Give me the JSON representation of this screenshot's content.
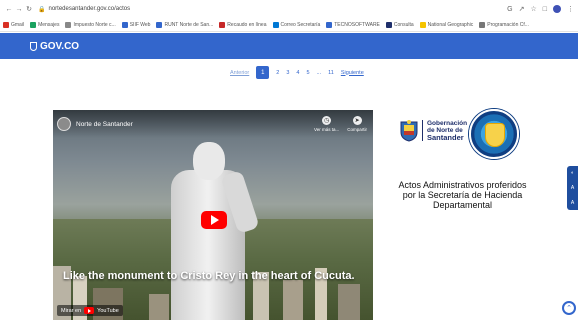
{
  "browser": {
    "url": "nortedesantander.gov.co/actos",
    "bookmarks": [
      {
        "label": "Gmail",
        "color": "#d93025"
      },
      {
        "label": "Mensajes",
        "color": "#1aa260"
      },
      {
        "label": "Impuesto Norte c...",
        "color": "#888888"
      },
      {
        "label": "SIIF Web",
        "color": "#3366cc"
      },
      {
        "label": "RUNT Norte de San...",
        "color": "#3366cc"
      },
      {
        "label": "Recaudo en línea",
        "color": "#c62828"
      },
      {
        "label": "Correo Secretaría",
        "color": "#0078d4"
      },
      {
        "label": "TECNOSOFTWARE",
        "color": "#3366cc"
      },
      {
        "label": "Consulta",
        "color": "#1f2f6b"
      },
      {
        "label": "National Geographic",
        "color": "#f5c400"
      },
      {
        "label": "Programación Cf...",
        "color": "#777777"
      }
    ]
  },
  "gov": {
    "logo_text": "GOV.CO"
  },
  "pagination": {
    "prev": "Anterior",
    "pages": [
      "1",
      "2",
      "3",
      "4",
      "5"
    ],
    "active": "1",
    "ellipsis": "...",
    "last": "11",
    "next": "Siguiente"
  },
  "video": {
    "channel_title": "Norte de Santander",
    "watch_later": "Ver más ta...",
    "share": "Compartir",
    "caption": "Like the monument to Cristo Rey in the heart of Cucuta.",
    "watch_on": "Mirar en",
    "youtube": "YouTube"
  },
  "logos": {
    "gob_line1": "Gobernación",
    "gob_line2": "de Norte de",
    "gob_line3": "Santander"
  },
  "actos_title": "Actos Administrativos proferidos por la Secretaría de Hacienda Departamental"
}
